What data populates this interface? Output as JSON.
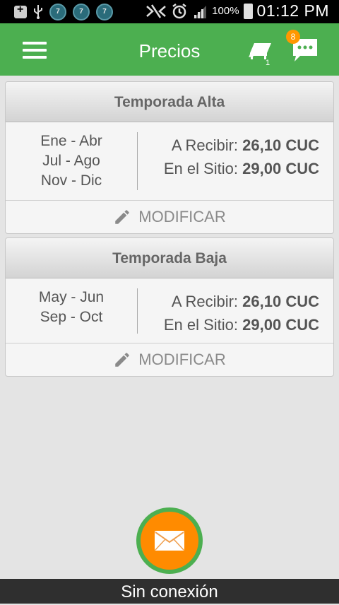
{
  "status_bar": {
    "battery_percent": "100%",
    "time": "01:12 PM",
    "app_icon_label": "7"
  },
  "app_bar": {
    "title": "Precios",
    "rooms_count": "1",
    "messages_badge": "8"
  },
  "seasons": [
    {
      "title": "Temporada Alta",
      "months": [
        "Ene - Abr",
        "Jul - Ago",
        "Nov - Dic"
      ],
      "receive_label": "A Recibir:",
      "receive_value": "26,10 CUC",
      "site_label": "En el Sitio:",
      "site_value": "29,00 CUC",
      "edit_label": "MODIFICAR"
    },
    {
      "title": "Temporada Baja",
      "months": [
        "May - Jun",
        "Sep - Oct"
      ],
      "receive_label": "A Recibir:",
      "receive_value": "26,10 CUC",
      "site_label": "En el Sitio:",
      "site_value": "29,00 CUC",
      "edit_label": "MODIFICAR"
    }
  ],
  "connection_status": "Sin conexión",
  "colors": {
    "primary": "#4caf50",
    "accent": "#ff8b00",
    "badge": "#ff9800"
  }
}
